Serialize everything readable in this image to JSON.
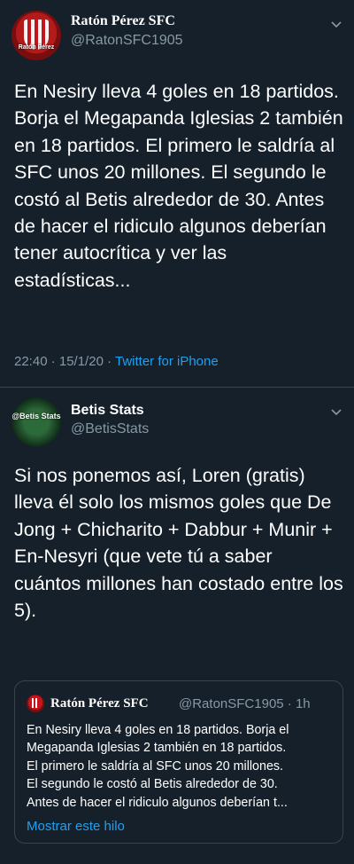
{
  "tweet1": {
    "avatar_text": "Ratón Pérez",
    "name": "Ratón Pérez SFC",
    "handle": "@RatonSFC1905",
    "body": "En Nesiry lleva 4 goles en 18 partidos. Borja el Megapanda Iglesias 2 también en 18 partidos. El primero le saldría al SFC unos 20 millones. El segundo le costó al Betis alrededor de 30. Antes de hacer el ridiculo algunos deberían tener autocrítica y ver las estadísticas...",
    "time": "22:40 · 15/1/20 · ",
    "source": "Twitter for iPhone"
  },
  "tweet2": {
    "avatar_text": "@Betis Stats",
    "name": "Betis Stats",
    "handle": "@BetisStats",
    "body": "Si nos ponemos así, Loren (gratis) lleva él solo los mismos goles que De Jong + Chicharito + Dabbur + Munir + En-Nesyri (que vete tú a saber cuántos millones han costado entre los 5).",
    "quote": {
      "name": "Ratón Pérez SFC",
      "handle_time": "@RatonSFC1905 · 1h",
      "lines": [
        "En Nesiry lleva 4 goles en 18 partidos. Borja el",
        "Megapanda Iglesias 2 también en 18 partidos.",
        "El primero le saldría al SFC unos 20 millones.",
        "El segundo le costó al Betis alrededor de 30.",
        "Antes de hacer el ridiculo algunos deberían t..."
      ],
      "show_thread": "Mostrar este hilo"
    }
  },
  "colors": {
    "background": "#15202b",
    "secondary_text": "#8899a6",
    "link": "#1da1f2",
    "border": "#38444d"
  },
  "icons": [
    "chevron-down-icon",
    "avatar-image"
  ]
}
